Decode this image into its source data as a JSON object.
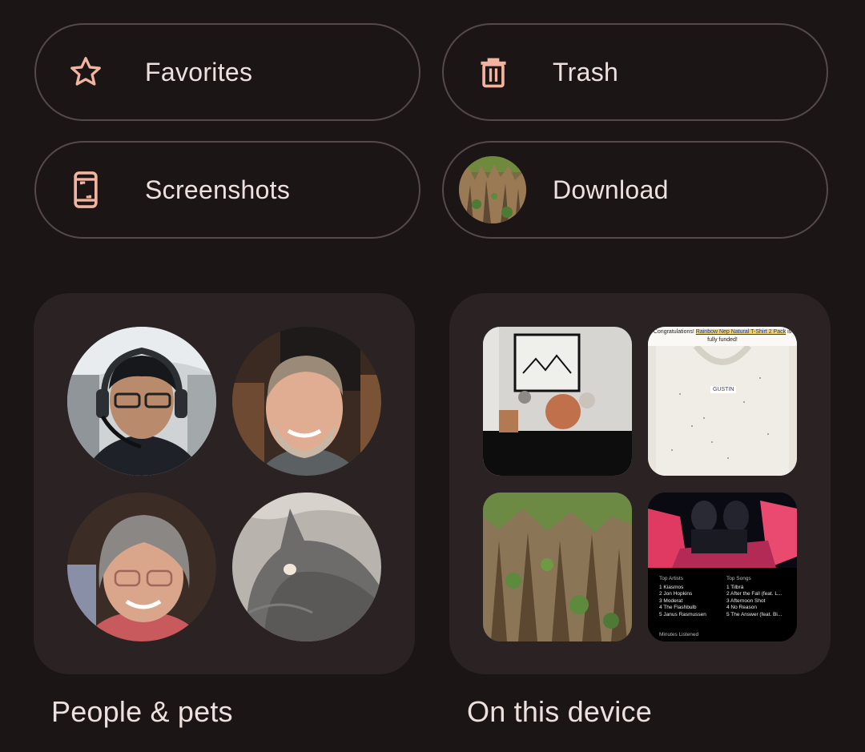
{
  "shortcuts": {
    "favorites": {
      "label": "Favorites",
      "icon": "star-outline-icon"
    },
    "trash": {
      "label": "Trash",
      "icon": "trash-icon"
    },
    "screenshots": {
      "label": "Screenshots",
      "icon": "phone-screenshot-icon"
    },
    "download": {
      "label": "Download",
      "icon": "folder-thumbnail"
    }
  },
  "collections": {
    "people": {
      "title": "People & pets",
      "faces": [
        "man-with-headset",
        "smiling-bearded-man",
        "woman-with-glasses",
        "gray-cat-closeup"
      ]
    },
    "device": {
      "title": "On this device",
      "thumbnails": {
        "shelf": "shelf-decor-photo",
        "shirt": {
          "banner_prefix": "Congratulations!",
          "banner_link": "Rainbow Nep Natural T-Shirt 2 Pack",
          "banner_suffix": "is fully funded!",
          "tag": "GUSTIN"
        },
        "cliffs": "cliffs-photo",
        "music": {
          "top_artists_label": "Top Artists",
          "top_songs_label": "Top Songs",
          "artists": [
            "1 Kiasmos",
            "2 Jon Hopkins",
            "3 Moderat",
            "4 The Flashbulb",
            "5 Janus Rasmussen"
          ],
          "songs": [
            "1 Tilbrá",
            "2 After the Fall (feat. L...",
            "3 Afternoon Shot",
            "4 No Reason",
            "5 The Answer (feat. Bi..."
          ],
          "footer": "Minutes Listened"
        }
      }
    }
  },
  "colors": {
    "background": "#1b1516",
    "card": "#2a2223",
    "outline": "#55494a",
    "icon_accent": "#f2b49f",
    "text": "#ede0dd"
  }
}
